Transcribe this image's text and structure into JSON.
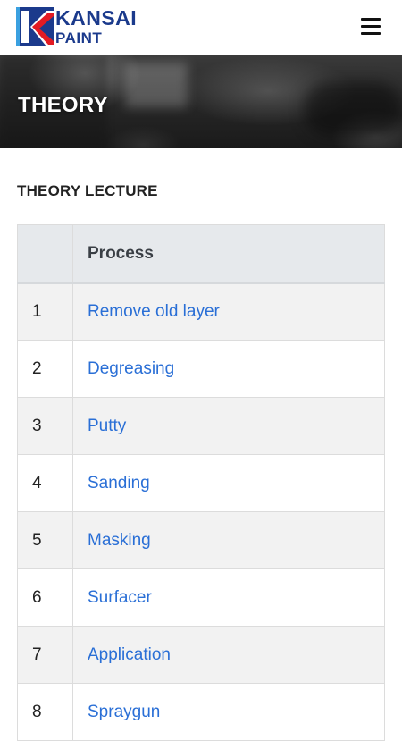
{
  "brand": {
    "name_line1": "KANSAI",
    "name_line2": "PAINT",
    "logo_colors": {
      "blue": "#1b3a8c",
      "red": "#e31b23",
      "light_blue": "#3aa0e0"
    }
  },
  "header": {
    "menu_icon": "hamburger-menu-icon"
  },
  "banner": {
    "title": "THEORY"
  },
  "content": {
    "section_title": "THEORY LECTURE",
    "table": {
      "headers": [
        "",
        "Process"
      ],
      "rows": [
        {
          "num": "1",
          "process": "Remove old layer"
        },
        {
          "num": "2",
          "process": "Degreasing"
        },
        {
          "num": "3",
          "process": "Putty"
        },
        {
          "num": "4",
          "process": "Sanding"
        },
        {
          "num": "5",
          "process": "Masking"
        },
        {
          "num": "6",
          "process": "Surfacer"
        },
        {
          "num": "7",
          "process": "Application"
        },
        {
          "num": "8",
          "process": "Spraygun"
        }
      ]
    }
  },
  "colors": {
    "link": "#2a6fd6",
    "header_bg": "#e6e9ec",
    "row_alt_bg": "#f2f2f2"
  }
}
